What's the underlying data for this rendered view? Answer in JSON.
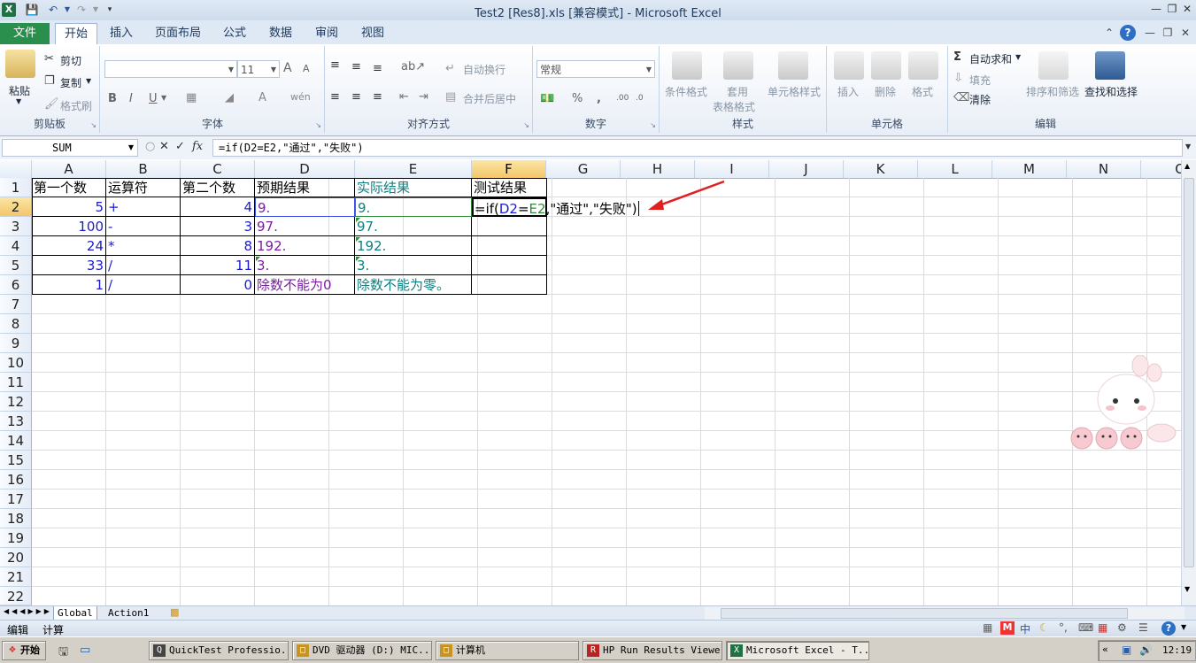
{
  "window": {
    "title": "Test2 [Res8].xls  [兼容模式] - Microsoft Excel"
  },
  "ribbon_tabs": [
    "文件",
    "开始",
    "插入",
    "页面布局",
    "公式",
    "数据",
    "审阅",
    "视图"
  ],
  "ribbon": {
    "clipboard": {
      "paste": "粘贴",
      "cut": "剪切",
      "copy": "复制",
      "format_painter": "格式刷",
      "label": "剪贴板"
    },
    "font": {
      "size": "11",
      "bold": "B",
      "italic": "I",
      "underline": "U",
      "grow": "A",
      "shrink": "A",
      "label": "字体"
    },
    "alignment": {
      "wrap": "自动换行",
      "merge": "合并后居中",
      "label": "对齐方式"
    },
    "number": {
      "format": "常规",
      "percent": "%",
      "comma": ",",
      "label": "数字"
    },
    "styles": {
      "conditional": "条件格式",
      "table": "套用",
      "table2": "表格格式",
      "cell_styles": "单元格样式",
      "label": "样式"
    },
    "cells": {
      "insert": "插入",
      "delete": "删除",
      "format": "格式",
      "label": "单元格"
    },
    "editing": {
      "autosum": "自动求和",
      "fill": "填充",
      "clear": "清除",
      "sort": "排序和筛选",
      "find": "查找和选择",
      "label": "编辑"
    }
  },
  "formula_bar": {
    "name_box": "SUM",
    "fx": "fx",
    "formula": "=if(D2=E2,\"通过\",\"失败\")"
  },
  "columns": [
    "A",
    "B",
    "C",
    "D",
    "E",
    "F",
    "G",
    "H",
    "I",
    "J",
    "K",
    "L",
    "M",
    "N",
    "O"
  ],
  "rows": [
    "1",
    "2",
    "3",
    "4",
    "5",
    "6",
    "7",
    "8",
    "9",
    "10",
    "11",
    "12",
    "13",
    "14",
    "15",
    "16",
    "17",
    "18",
    "19",
    "20",
    "21",
    "22"
  ],
  "sheet": {
    "header": [
      "第一个数",
      "运算符",
      "第二个数",
      "预期结果",
      "实际结果",
      "测试结果"
    ],
    "data": [
      [
        "5",
        "+",
        "4",
        "9.",
        "9."
      ],
      [
        "100",
        "-",
        "3",
        "97.",
        "97."
      ],
      [
        "24",
        "*",
        "8",
        "192.",
        "192."
      ],
      [
        "33",
        "/",
        "11",
        "3.",
        "3."
      ],
      [
        "1",
        "/",
        "0",
        "除数不能为0",
        "除数不能为零。"
      ]
    ],
    "editing_cell": {
      "prefix": "=if(",
      "ref1": "D2",
      "eq": "=",
      "ref2": "E2",
      "rest": ",\"通过\",\"失败\")"
    }
  },
  "sheet_tabs": [
    "Global",
    "Action1"
  ],
  "status": {
    "mode": "编辑",
    "calc": "计算"
  },
  "taskbar": {
    "start": "开始",
    "items": [
      "QuickTest Professio...",
      "DVD 驱动器 (D:) MIC...",
      "计算机",
      "HP Run Results Viewer",
      "Microsoft Excel - T..."
    ],
    "clock": "12:19"
  },
  "colors": {
    "excel_green": "#1f7244",
    "selection_orange": "#f3c66a",
    "arrow_red": "#e02020"
  }
}
